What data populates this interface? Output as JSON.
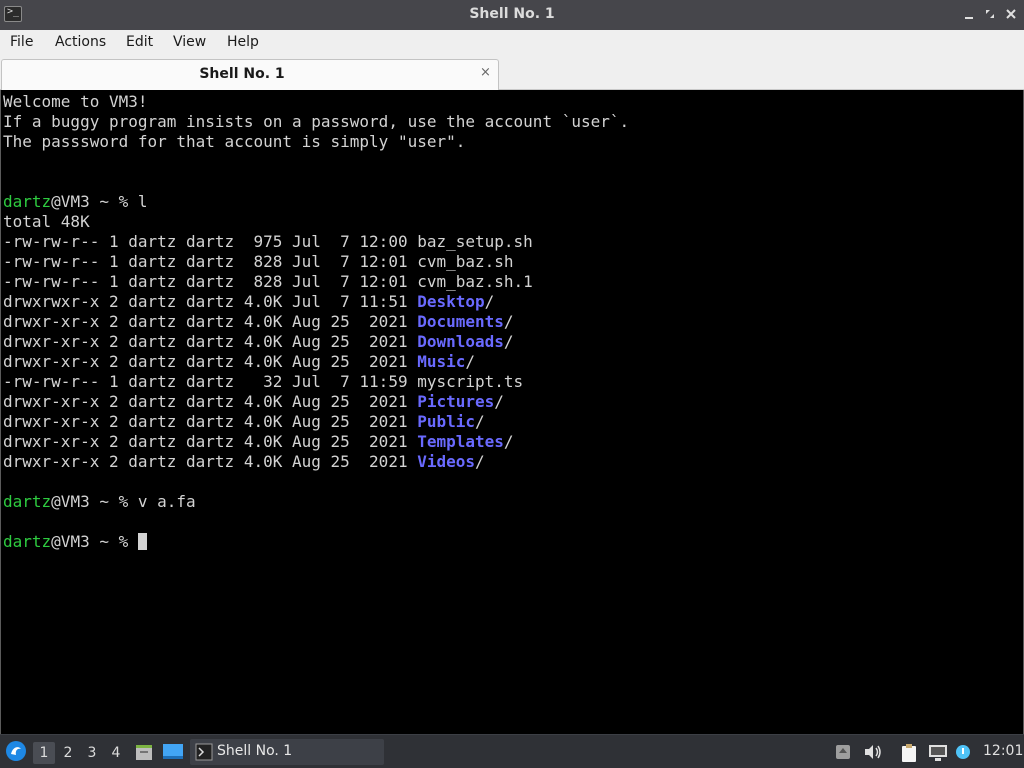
{
  "window": {
    "title": "Shell No. 1",
    "app_icon_glyph": ">_"
  },
  "menubar": {
    "items": [
      "File",
      "Actions",
      "Edit",
      "View",
      "Help"
    ]
  },
  "tabs": [
    {
      "label": "Shell No. 1",
      "close_glyph": "×"
    }
  ],
  "terminal": {
    "welcome": [
      "Welcome to VM3!",
      "If a buggy program insists on a password, use the account `user`.",
      "The passsword for that account is simply \"user\"."
    ],
    "prompt_user": "dartz",
    "prompt_rest": "@VM3 ~ % ",
    "cmd1": "l",
    "total": "total 48K",
    "listing": [
      {
        "meta": "-rw-rw-r-- 1 dartz dartz  975 Jul  7 12:00 ",
        "name": "baz_setup.sh",
        "is_dir": false
      },
      {
        "meta": "-rw-rw-r-- 1 dartz dartz  828 Jul  7 12:01 ",
        "name": "cvm_baz.sh",
        "is_dir": false
      },
      {
        "meta": "-rw-rw-r-- 1 dartz dartz  828 Jul  7 12:01 ",
        "name": "cvm_baz.sh.1",
        "is_dir": false
      },
      {
        "meta": "drwxrwxr-x 2 dartz dartz 4.0K Jul  7 11:51 ",
        "name": "Desktop",
        "is_dir": true
      },
      {
        "meta": "drwxr-xr-x 2 dartz dartz 4.0K Aug 25  2021 ",
        "name": "Documents",
        "is_dir": true
      },
      {
        "meta": "drwxr-xr-x 2 dartz dartz 4.0K Aug 25  2021 ",
        "name": "Downloads",
        "is_dir": true
      },
      {
        "meta": "drwxr-xr-x 2 dartz dartz 4.0K Aug 25  2021 ",
        "name": "Music",
        "is_dir": true
      },
      {
        "meta": "-rw-rw-r-- 1 dartz dartz   32 Jul  7 11:59 ",
        "name": "myscript.ts",
        "is_dir": false
      },
      {
        "meta": "drwxr-xr-x 2 dartz dartz 4.0K Aug 25  2021 ",
        "name": "Pictures",
        "is_dir": true
      },
      {
        "meta": "drwxr-xr-x 2 dartz dartz 4.0K Aug 25  2021 ",
        "name": "Public",
        "is_dir": true
      },
      {
        "meta": "drwxr-xr-x 2 dartz dartz 4.0K Aug 25  2021 ",
        "name": "Templates",
        "is_dir": true
      },
      {
        "meta": "drwxr-xr-x 2 dartz dartz 4.0K Aug 25  2021 ",
        "name": "Videos",
        "is_dir": true
      }
    ],
    "dir_suffix": "/",
    "cmd2": "v a.fa",
    "cmd3": ""
  },
  "taskbar": {
    "workspaces": [
      "1",
      "2",
      "3",
      "4"
    ],
    "active_workspace": "1",
    "task_label": "Shell No. 1",
    "clock": "12:01"
  },
  "icons": {
    "app_menu": "start-menu-icon",
    "file_manager": "file-manager-icon",
    "desktop": "show-desktop-icon",
    "volume": "volume-icon",
    "clipboard": "clipboard-icon",
    "network": "network-icon",
    "update": "update-notifier-icon"
  },
  "colors": {
    "prompt_user": "#2ecc40",
    "directory": "#6a6aff",
    "terminal_bg": "#000000",
    "terminal_fg": "#d3d3d3"
  }
}
